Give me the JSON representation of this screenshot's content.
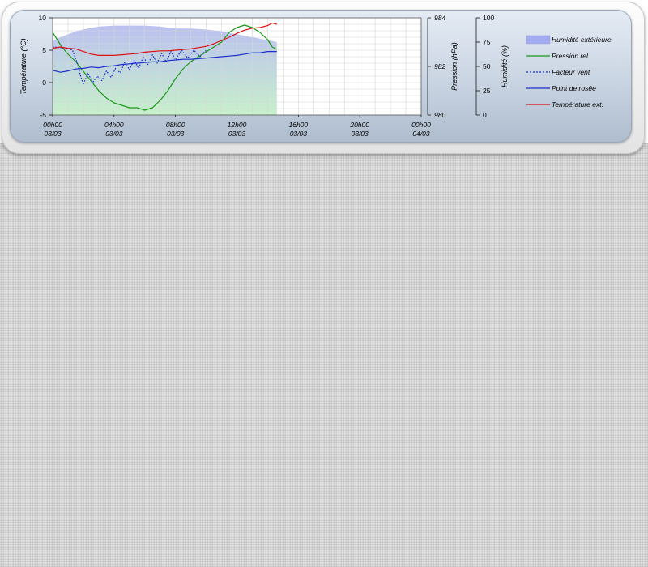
{
  "colors": {
    "humidity_fill": "#b7bdf0",
    "humidity_fill_lower": "#c4f0c8",
    "pressure": "#1a9a1a",
    "wind_chill": "#1a2ecc",
    "dew_point": "#1a2ecc",
    "temperature": "#dd1111"
  },
  "axes": {
    "left_label": "Température (°C)",
    "right1_label": "Pression (hPa)",
    "right2_label": "Humidité (%)"
  },
  "chart_data": {
    "type": "line",
    "x_unit": "hours since 00h00 03/03",
    "x_range": [
      0,
      24
    ],
    "x_ticks": [
      {
        "time": "00h00",
        "date": "03/03"
      },
      {
        "time": "04h00",
        "date": "03/03"
      },
      {
        "time": "08h00",
        "date": "03/03"
      },
      {
        "time": "12h00",
        "date": "03/03"
      },
      {
        "time": "16h00",
        "date": "03/03"
      },
      {
        "time": "20h00",
        "date": "03/03"
      },
      {
        "time": "00h00",
        "date": "04/03"
      }
    ],
    "y_left": {
      "range": [
        -5,
        10
      ],
      "ticks": [
        "10",
        "5",
        "0",
        "-5"
      ]
    },
    "y_pressure": {
      "range": [
        980,
        984
      ],
      "ticks": [
        "984",
        "982",
        "980"
      ]
    },
    "y_humidity": {
      "range": [
        0,
        100
      ],
      "ticks": [
        "100",
        "75",
        "50",
        "25",
        "0"
      ]
    },
    "grid": true,
    "legend_position": "right",
    "series": [
      {
        "name": "Humidité extérieure",
        "axis": "humidity",
        "style": "area",
        "x": [
          0,
          0.5,
          1,
          1.5,
          2,
          3,
          4,
          5,
          6,
          7,
          8,
          9,
          10,
          11,
          12,
          13,
          14,
          14.6
        ],
        "y": [
          76,
          80,
          83,
          86,
          88,
          91,
          92,
          92,
          92,
          91,
          89,
          89,
          88,
          86,
          83,
          80,
          77,
          75
        ]
      },
      {
        "name": "Pression rel.",
        "axis": "pressure",
        "style": "line",
        "x": [
          0,
          0.3,
          0.6,
          1,
          1.5,
          2,
          2.5,
          3,
          3.5,
          4,
          4.5,
          5,
          5.5,
          6,
          6.5,
          7,
          7.5,
          8,
          8.5,
          9,
          9.5,
          10,
          10.5,
          11,
          11.5,
          12,
          12.5,
          13,
          13.5,
          14,
          14.3,
          14.6
        ],
        "y": [
          983.4,
          983.1,
          982.8,
          982.5,
          982.2,
          981.8,
          981.4,
          981.0,
          980.7,
          980.5,
          980.4,
          980.3,
          980.3,
          980.2,
          980.3,
          980.6,
          981.0,
          981.5,
          981.9,
          982.2,
          982.4,
          982.6,
          982.8,
          983.0,
          983.4,
          983.6,
          983.7,
          983.6,
          983.4,
          983.1,
          982.8,
          982.7
        ]
      },
      {
        "name": "Facteur vent",
        "axis": "temperature",
        "style": "dotted",
        "x": [
          0,
          0.5,
          1,
          1.3,
          1.6,
          1.8,
          2,
          2.3,
          2.6,
          2.9,
          3.2,
          3.5,
          3.8,
          4.1,
          4.4,
          4.7,
          5,
          5.3,
          5.6,
          5.9,
          6.2,
          6.5,
          6.8,
          7.1,
          7.4,
          7.7,
          8,
          8.4,
          8.8,
          9.2,
          9.6,
          10
        ],
        "y": [
          5.5,
          5.4,
          5.3,
          5.0,
          3.0,
          1.2,
          -0.3,
          1.5,
          0.0,
          1.0,
          0.3,
          1.8,
          0.8,
          2.2,
          1.5,
          3.2,
          2.0,
          3.5,
          2.2,
          4.0,
          2.8,
          4.3,
          3.0,
          4.5,
          3.2,
          4.8,
          3.6,
          5.0,
          3.8,
          5.0,
          4.0,
          5.0
        ]
      },
      {
        "name": "Point de rosée",
        "axis": "temperature",
        "style": "line",
        "x": [
          0,
          0.5,
          1,
          1.5,
          2,
          2.5,
          3,
          3.5,
          4,
          4.5,
          5,
          5.5,
          6,
          6.5,
          7,
          7.5,
          8,
          8.5,
          9,
          9.5,
          10,
          10.5,
          11,
          11.5,
          12,
          12.5,
          13,
          13.5,
          14,
          14.6
        ],
        "y": [
          1.9,
          1.6,
          1.8,
          2.1,
          2.2,
          2.4,
          2.3,
          2.5,
          2.6,
          2.8,
          2.9,
          3.0,
          3.1,
          3.2,
          3.2,
          3.4,
          3.5,
          3.6,
          3.6,
          3.7,
          3.8,
          3.9,
          4.0,
          4.1,
          4.2,
          4.4,
          4.6,
          4.6,
          4.8,
          4.8
        ]
      },
      {
        "name": "Température ext.",
        "axis": "temperature",
        "style": "line",
        "x": [
          0,
          0.5,
          1,
          1.5,
          2,
          2.5,
          3,
          3.5,
          4,
          4.5,
          5,
          5.5,
          6,
          6.5,
          7,
          7.5,
          8,
          8.5,
          9,
          9.5,
          10,
          10.5,
          11,
          11.5,
          12,
          12.5,
          13,
          13.5,
          14,
          14.3,
          14.6
        ],
        "y": [
          5.3,
          5.5,
          5.3,
          5.2,
          4.8,
          4.4,
          4.2,
          4.2,
          4.2,
          4.3,
          4.4,
          4.5,
          4.7,
          4.8,
          4.9,
          4.9,
          5.0,
          5.1,
          5.2,
          5.4,
          5.6,
          6.0,
          6.5,
          7.0,
          7.6,
          8.1,
          8.4,
          8.5,
          8.8,
          9.2,
          9.0
        ]
      }
    ]
  }
}
